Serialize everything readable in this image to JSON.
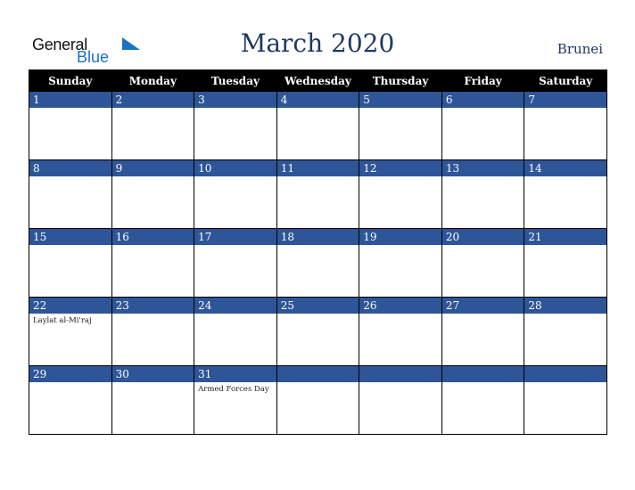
{
  "logo": {
    "line1": "General",
    "line2": "Blue"
  },
  "title": "March 2020",
  "country": "Brunei",
  "colors": {
    "band": "#2e5597",
    "title": "#1f3864",
    "header_bg": "#000000",
    "logo_blue": "#1a73c1"
  },
  "weekdays": [
    "Sunday",
    "Monday",
    "Tuesday",
    "Wednesday",
    "Thursday",
    "Friday",
    "Saturday"
  ],
  "weeks": [
    [
      {
        "day": "1",
        "event": ""
      },
      {
        "day": "2",
        "event": ""
      },
      {
        "day": "3",
        "event": ""
      },
      {
        "day": "4",
        "event": ""
      },
      {
        "day": "5",
        "event": ""
      },
      {
        "day": "6",
        "event": ""
      },
      {
        "day": "7",
        "event": ""
      }
    ],
    [
      {
        "day": "8",
        "event": ""
      },
      {
        "day": "9",
        "event": ""
      },
      {
        "day": "10",
        "event": ""
      },
      {
        "day": "11",
        "event": ""
      },
      {
        "day": "12",
        "event": ""
      },
      {
        "day": "13",
        "event": ""
      },
      {
        "day": "14",
        "event": ""
      }
    ],
    [
      {
        "day": "15",
        "event": ""
      },
      {
        "day": "16",
        "event": ""
      },
      {
        "day": "17",
        "event": ""
      },
      {
        "day": "18",
        "event": ""
      },
      {
        "day": "19",
        "event": ""
      },
      {
        "day": "20",
        "event": ""
      },
      {
        "day": "21",
        "event": ""
      }
    ],
    [
      {
        "day": "22",
        "event": "Laylat al-Mi'raj"
      },
      {
        "day": "23",
        "event": ""
      },
      {
        "day": "24",
        "event": ""
      },
      {
        "day": "25",
        "event": ""
      },
      {
        "day": "26",
        "event": ""
      },
      {
        "day": "27",
        "event": ""
      },
      {
        "day": "28",
        "event": ""
      }
    ],
    [
      {
        "day": "29",
        "event": ""
      },
      {
        "day": "30",
        "event": ""
      },
      {
        "day": "31",
        "event": "Armed Forces Day"
      },
      {
        "day": "",
        "event": ""
      },
      {
        "day": "",
        "event": ""
      },
      {
        "day": "",
        "event": ""
      },
      {
        "day": "",
        "event": ""
      }
    ]
  ]
}
